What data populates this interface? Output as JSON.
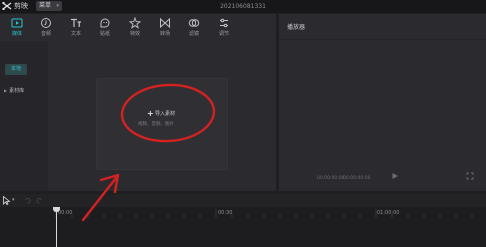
{
  "app": {
    "name": "剪映",
    "menu_label": "菜单",
    "project_title": "202106081331"
  },
  "toolbar": {
    "tabs": [
      {
        "label": "媒体",
        "icon": "media-icon",
        "active": true
      },
      {
        "label": "音频",
        "icon": "audio-icon",
        "active": false
      },
      {
        "label": "文本",
        "icon": "text-icon",
        "active": false
      },
      {
        "label": "贴纸",
        "icon": "sticker-icon",
        "active": false
      },
      {
        "label": "特效",
        "icon": "effects-icon",
        "active": false
      },
      {
        "label": "转场",
        "icon": "transition-icon",
        "active": false
      },
      {
        "label": "滤镜",
        "icon": "filter-icon",
        "active": false
      },
      {
        "label": "调节",
        "icon": "adjust-icon",
        "active": false
      }
    ],
    "accent_color": "#29c4cf"
  },
  "sidebar": {
    "add_label": "本地",
    "library_label": "素材库"
  },
  "import": {
    "label": "导入素材",
    "hint": "视频、音频、图片"
  },
  "player": {
    "title": "播放器",
    "current_time": "00:00:00:00",
    "total_time": "00:00:00:00"
  },
  "timeline": {
    "ruler_labels": [
      "00:00",
      "00:30",
      "01:00:00"
    ]
  },
  "annotation": {
    "color": "#d42121"
  }
}
